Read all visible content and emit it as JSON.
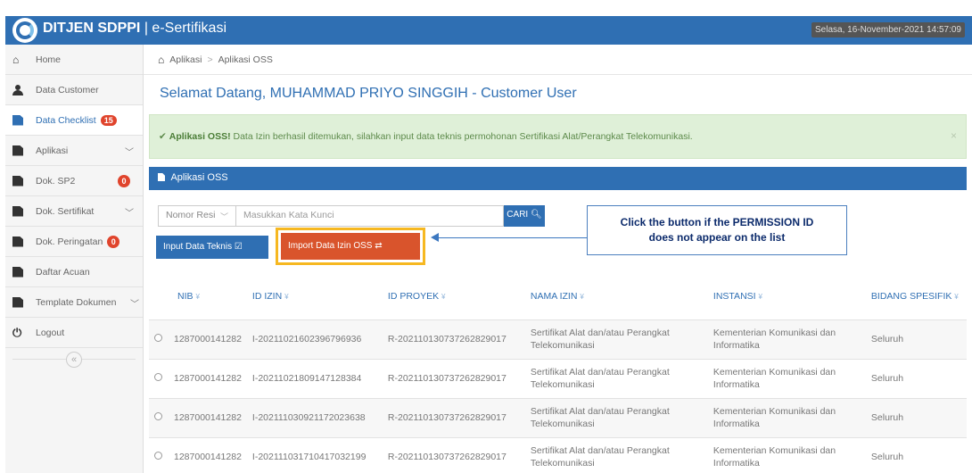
{
  "header": {
    "brand": "DITJEN SDPPI",
    "separator": "|",
    "app_name": "e-Sertifikasi",
    "datetime": "Selasa, 16-November-2021 14:57:09",
    "color": "#2f6fb3"
  },
  "sidebar": {
    "items": [
      {
        "label": "Home",
        "icon": "home-icon"
      },
      {
        "label": "Data Customer",
        "icon": "user-icon"
      },
      {
        "label": "Data Checklist",
        "icon": "document-icon",
        "badge": "15",
        "active": true
      },
      {
        "label": "Aplikasi",
        "icon": "document-icon",
        "chevron": "﹀"
      },
      {
        "label": "Dok. SP2",
        "icon": "document-icon",
        "badge": "0"
      },
      {
        "label": "Dok. Sertifikat",
        "icon": "document-icon",
        "chevron": "﹀"
      },
      {
        "label": "Dok. Peringatan",
        "icon": "document-icon",
        "badge": "0"
      },
      {
        "label": "Daftar Acuan",
        "icon": "document-icon"
      },
      {
        "label": "Template Dokumen",
        "icon": "document-icon",
        "chevron": "﹀"
      },
      {
        "label": "Logout",
        "icon": "power-icon"
      }
    ],
    "collapse": "«"
  },
  "breadcrumb": {
    "items": [
      "Aplikasi",
      "Aplikasi OSS"
    ],
    "sep": ">"
  },
  "page": {
    "title": "Selamat Datang, MUHAMMAD PRIYO SINGGIH - Customer User"
  },
  "alert": {
    "check": "✔",
    "strong": "Aplikasi OSS!",
    "text": " Data Izin berhasil ditemukan, silahkan input data teknis permohonan Sertifikasi Alat/Perangkat Telekomunikasi.",
    "close": "×"
  },
  "panel": {
    "title": "Aplikasi OSS"
  },
  "search": {
    "select_value": "Nomor Resi",
    "placeholder": "Masukkan Kata Kunci",
    "button": "CARI"
  },
  "buttons": {
    "input": "Input Data Teknis",
    "import": "Import Data Izin OSS"
  },
  "callout": {
    "line1": "Click the button if the PERMISSION ID",
    "line2": "does not appear on the list"
  },
  "table": {
    "columns": [
      "NIB",
      "ID IZIN",
      "ID PROYEK",
      "NAMA IZIN",
      "INSTANSI",
      "BIDANG SPESIFIK"
    ],
    "sort_icon": "¥",
    "rows": [
      [
        "1287000141282",
        "I-202110216023967969​36",
        "R-202110130737262829017",
        "Sertifikat Alat dan/atau Perangkat Telekomunikasi",
        "Kementerian Komunikasi dan Informatika",
        "Seluruh"
      ],
      [
        "1287000141282",
        "I-202110218091471283​84",
        "R-202110130737262829017",
        "Sertifikat Alat dan/atau Perangkat Telekomunikasi",
        "Kementerian Komunikasi dan Informatika",
        "Seluruh"
      ],
      [
        "1287000141282",
        "I-202111030921172023638",
        "R-202110130737262829017",
        "Sertifikat Alat dan/atau Perangkat Telekomunikasi",
        "Kementerian Komunikasi dan Informatika",
        "Seluruh"
      ],
      [
        "1287000141282",
        "I-202111031710417032199",
        "R-202110130737262829017",
        "Sertifikat Alat dan/atau Perangkat Telekomunikasi",
        "Kementerian Komunikasi dan Informatika",
        "Seluruh"
      ]
    ]
  }
}
